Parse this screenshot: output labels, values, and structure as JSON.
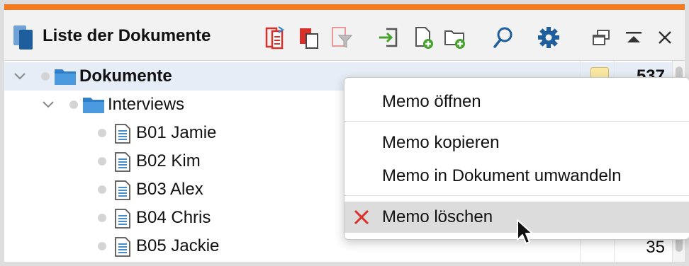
{
  "colors": {
    "accent": "#f47a20",
    "selection": "#e6edf6",
    "folder": "#2f80c8",
    "delete_red": "#d9302a",
    "add_green": "#46a32e"
  },
  "toolbar": {
    "title": "Liste der Dokumente",
    "buttons": [
      {
        "name": "import-red-icon"
      },
      {
        "name": "copy-docs-icon"
      },
      {
        "name": "filter-icon"
      },
      {
        "name": "login-import-icon"
      },
      {
        "name": "new-document-icon"
      },
      {
        "name": "new-folder-icon"
      },
      {
        "name": "search-icon"
      },
      {
        "name": "gear-icon"
      },
      {
        "name": "undock-window-icon"
      },
      {
        "name": "collapse-up-icon"
      },
      {
        "name": "close-icon"
      }
    ]
  },
  "tree": {
    "root": {
      "label": "Dokumente",
      "count": "537",
      "has_memo": true
    },
    "folder": {
      "label": "Interviews"
    },
    "documents": [
      {
        "label": "B01 Jamie"
      },
      {
        "label": "B02 Kim"
      },
      {
        "label": "B03 Alex"
      },
      {
        "label": "B04 Chris"
      },
      {
        "label": "B05 Jackie",
        "count": "35"
      }
    ]
  },
  "context_menu": {
    "items": [
      {
        "label": "Memo öffnen"
      },
      {
        "label": "Memo kopieren"
      },
      {
        "label": "Memo in Dokument umwandeln"
      },
      {
        "label": "Memo löschen",
        "icon": "x-delete-icon",
        "hovered": true
      }
    ]
  }
}
